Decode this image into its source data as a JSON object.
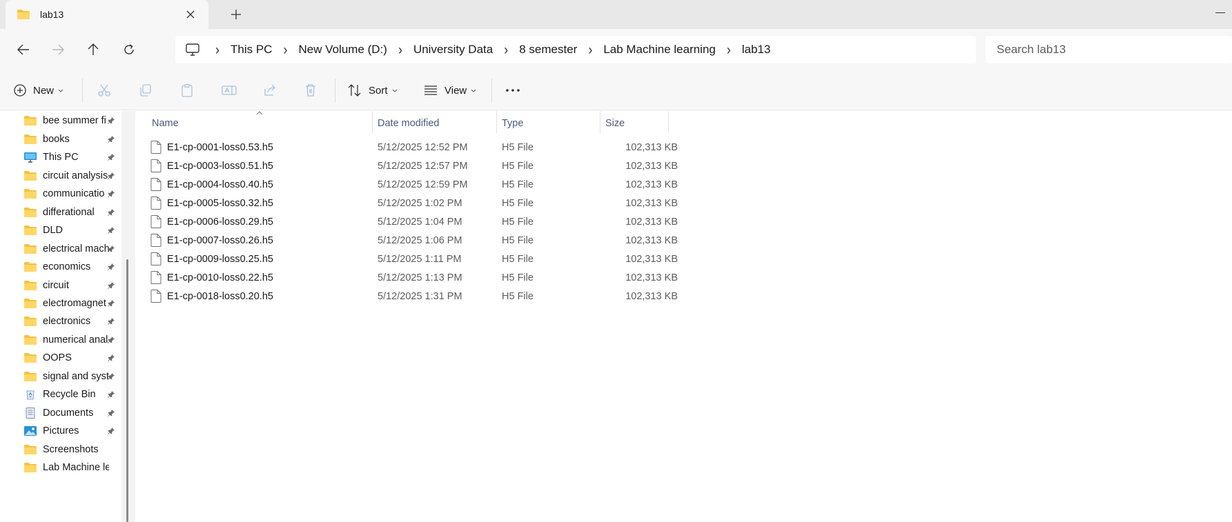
{
  "tab": {
    "title": "lab13",
    "close_icon": "close-icon",
    "new_tab_icon": "plus-icon"
  },
  "breadcrumb": [
    "This PC",
    "New Volume (D:)",
    "University Data",
    "8 semester",
    "Lab Machine learning",
    "lab13"
  ],
  "search": {
    "placeholder": "Search lab13"
  },
  "toolbar": {
    "new_label": "New",
    "sort_label": "Sort",
    "view_label": "View"
  },
  "sidebar": {
    "items": [
      {
        "label": "bee summer fi",
        "icon": "folder-icon"
      },
      {
        "label": "books",
        "icon": "folder-icon"
      },
      {
        "label": "This PC",
        "icon": "monitor-icon"
      },
      {
        "label": "circuit analysis",
        "icon": "folder-icon"
      },
      {
        "label": "communicatio",
        "icon": "folder-icon"
      },
      {
        "label": "differational",
        "icon": "folder-icon"
      },
      {
        "label": "DLD",
        "icon": "folder-icon"
      },
      {
        "label": "electrical mach",
        "icon": "folder-icon"
      },
      {
        "label": "economics",
        "icon": "folder-icon"
      },
      {
        "label": "circuit",
        "icon": "folder-icon"
      },
      {
        "label": "electromagnet",
        "icon": "folder-icon"
      },
      {
        "label": "electronics",
        "icon": "folder-icon"
      },
      {
        "label": "numerical anal",
        "icon": "folder-icon"
      },
      {
        "label": "OOPS",
        "icon": "folder-icon"
      },
      {
        "label": "signal and syst",
        "icon": "folder-icon"
      },
      {
        "label": "Recycle Bin",
        "icon": "recycle-bin-icon"
      },
      {
        "label": "Documents",
        "icon": "documents-icon"
      },
      {
        "label": "Pictures",
        "icon": "pictures-icon"
      },
      {
        "label": "Screenshots",
        "icon": "folder-icon"
      },
      {
        "label": "Lab Machine learn",
        "icon": "folder-icon"
      }
    ]
  },
  "columns": {
    "name": "Name",
    "date": "Date modified",
    "type": "Type",
    "size": "Size"
  },
  "files": [
    {
      "name": "E1-cp-0001-loss0.53.h5",
      "date": "5/12/2025 12:52 PM",
      "type": "H5 File",
      "size": "102,313 KB"
    },
    {
      "name": "E1-cp-0003-loss0.51.h5",
      "date": "5/12/2025 12:57 PM",
      "type": "H5 File",
      "size": "102,313 KB"
    },
    {
      "name": "E1-cp-0004-loss0.40.h5",
      "date": "5/12/2025 12:59 PM",
      "type": "H5 File",
      "size": "102,313 KB"
    },
    {
      "name": "E1-cp-0005-loss0.32.h5",
      "date": "5/12/2025 1:02 PM",
      "type": "H5 File",
      "size": "102,313 KB"
    },
    {
      "name": "E1-cp-0006-loss0.29.h5",
      "date": "5/12/2025 1:04 PM",
      "type": "H5 File",
      "size": "102,313 KB"
    },
    {
      "name": "E1-cp-0007-loss0.26.h5",
      "date": "5/12/2025 1:06 PM",
      "type": "H5 File",
      "size": "102,313 KB"
    },
    {
      "name": "E1-cp-0009-loss0.25.h5",
      "date": "5/12/2025 1:11 PM",
      "type": "H5 File",
      "size": "102,313 KB"
    },
    {
      "name": "E1-cp-0010-loss0.22.h5",
      "date": "5/12/2025 1:13 PM",
      "type": "H5 File",
      "size": "102,313 KB"
    },
    {
      "name": "E1-cp-0018-loss0.20.h5",
      "date": "5/12/2025 1:31 PM",
      "type": "H5 File",
      "size": "102,313 KB"
    }
  ],
  "colors": {
    "folder": "#f5c342",
    "accent": "#0067c0",
    "header_text": "#4a5b7a"
  }
}
